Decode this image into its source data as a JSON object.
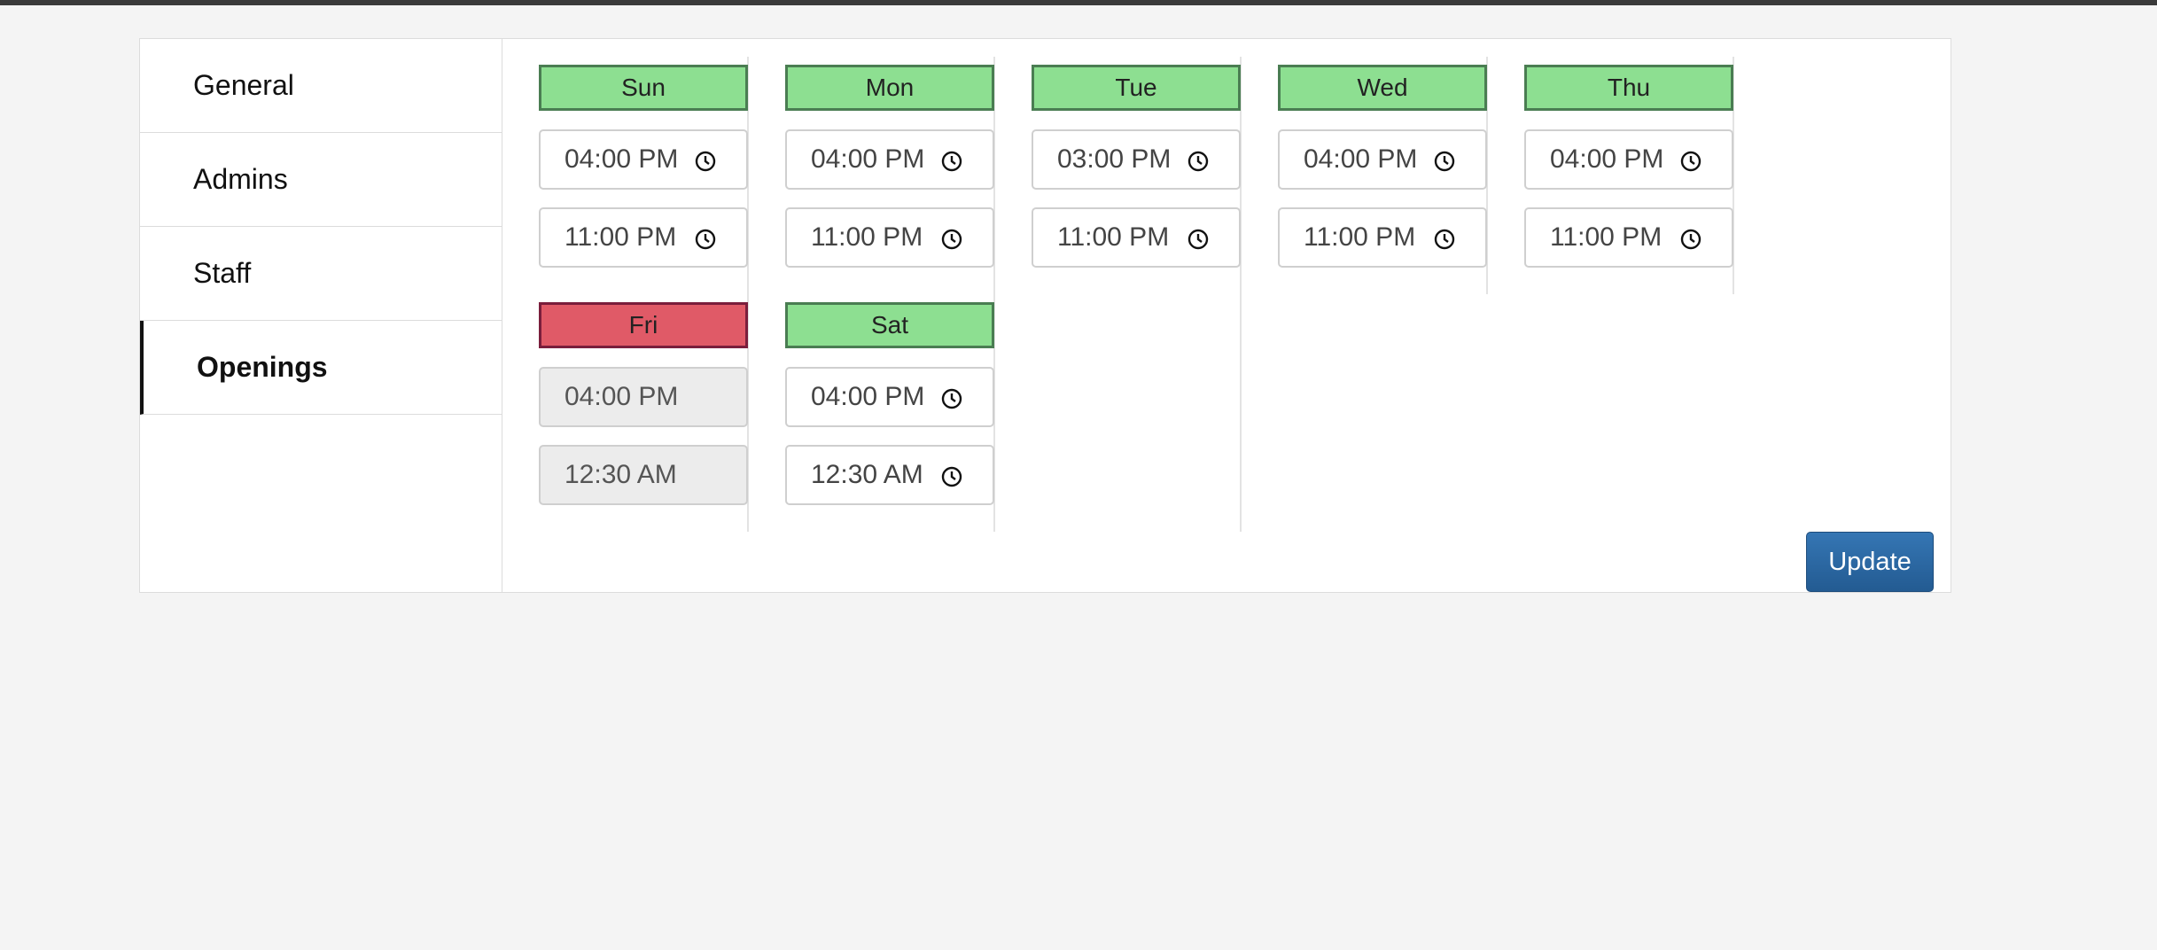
{
  "sidebar": {
    "items": [
      {
        "label": "General"
      },
      {
        "label": "Admins"
      },
      {
        "label": "Staff"
      },
      {
        "label": "Openings",
        "active": true
      }
    ]
  },
  "days": [
    {
      "name": "Sun",
      "open": "04:00 PM",
      "close": "11:00 PM",
      "closed": false
    },
    {
      "name": "Mon",
      "open": "04:00 PM",
      "close": "11:00 PM",
      "closed": false
    },
    {
      "name": "Tue",
      "open": "03:00 PM",
      "close": "11:00 PM",
      "closed": false
    },
    {
      "name": "Wed",
      "open": "04:00 PM",
      "close": "11:00 PM",
      "closed": false
    },
    {
      "name": "Thu",
      "open": "04:00 PM",
      "close": "11:00 PM",
      "closed": false
    },
    {
      "name": "Fri",
      "open": "04:00 PM",
      "close": "12:30 AM",
      "closed": true
    },
    {
      "name": "Sat",
      "open": "04:00 PM",
      "close": "12:30 AM",
      "closed": false
    }
  ],
  "update_label": "Update",
  "colors": {
    "open_day": "#8ddf91",
    "closed_day": "#e05a67",
    "update_button": "#2c68a4"
  }
}
